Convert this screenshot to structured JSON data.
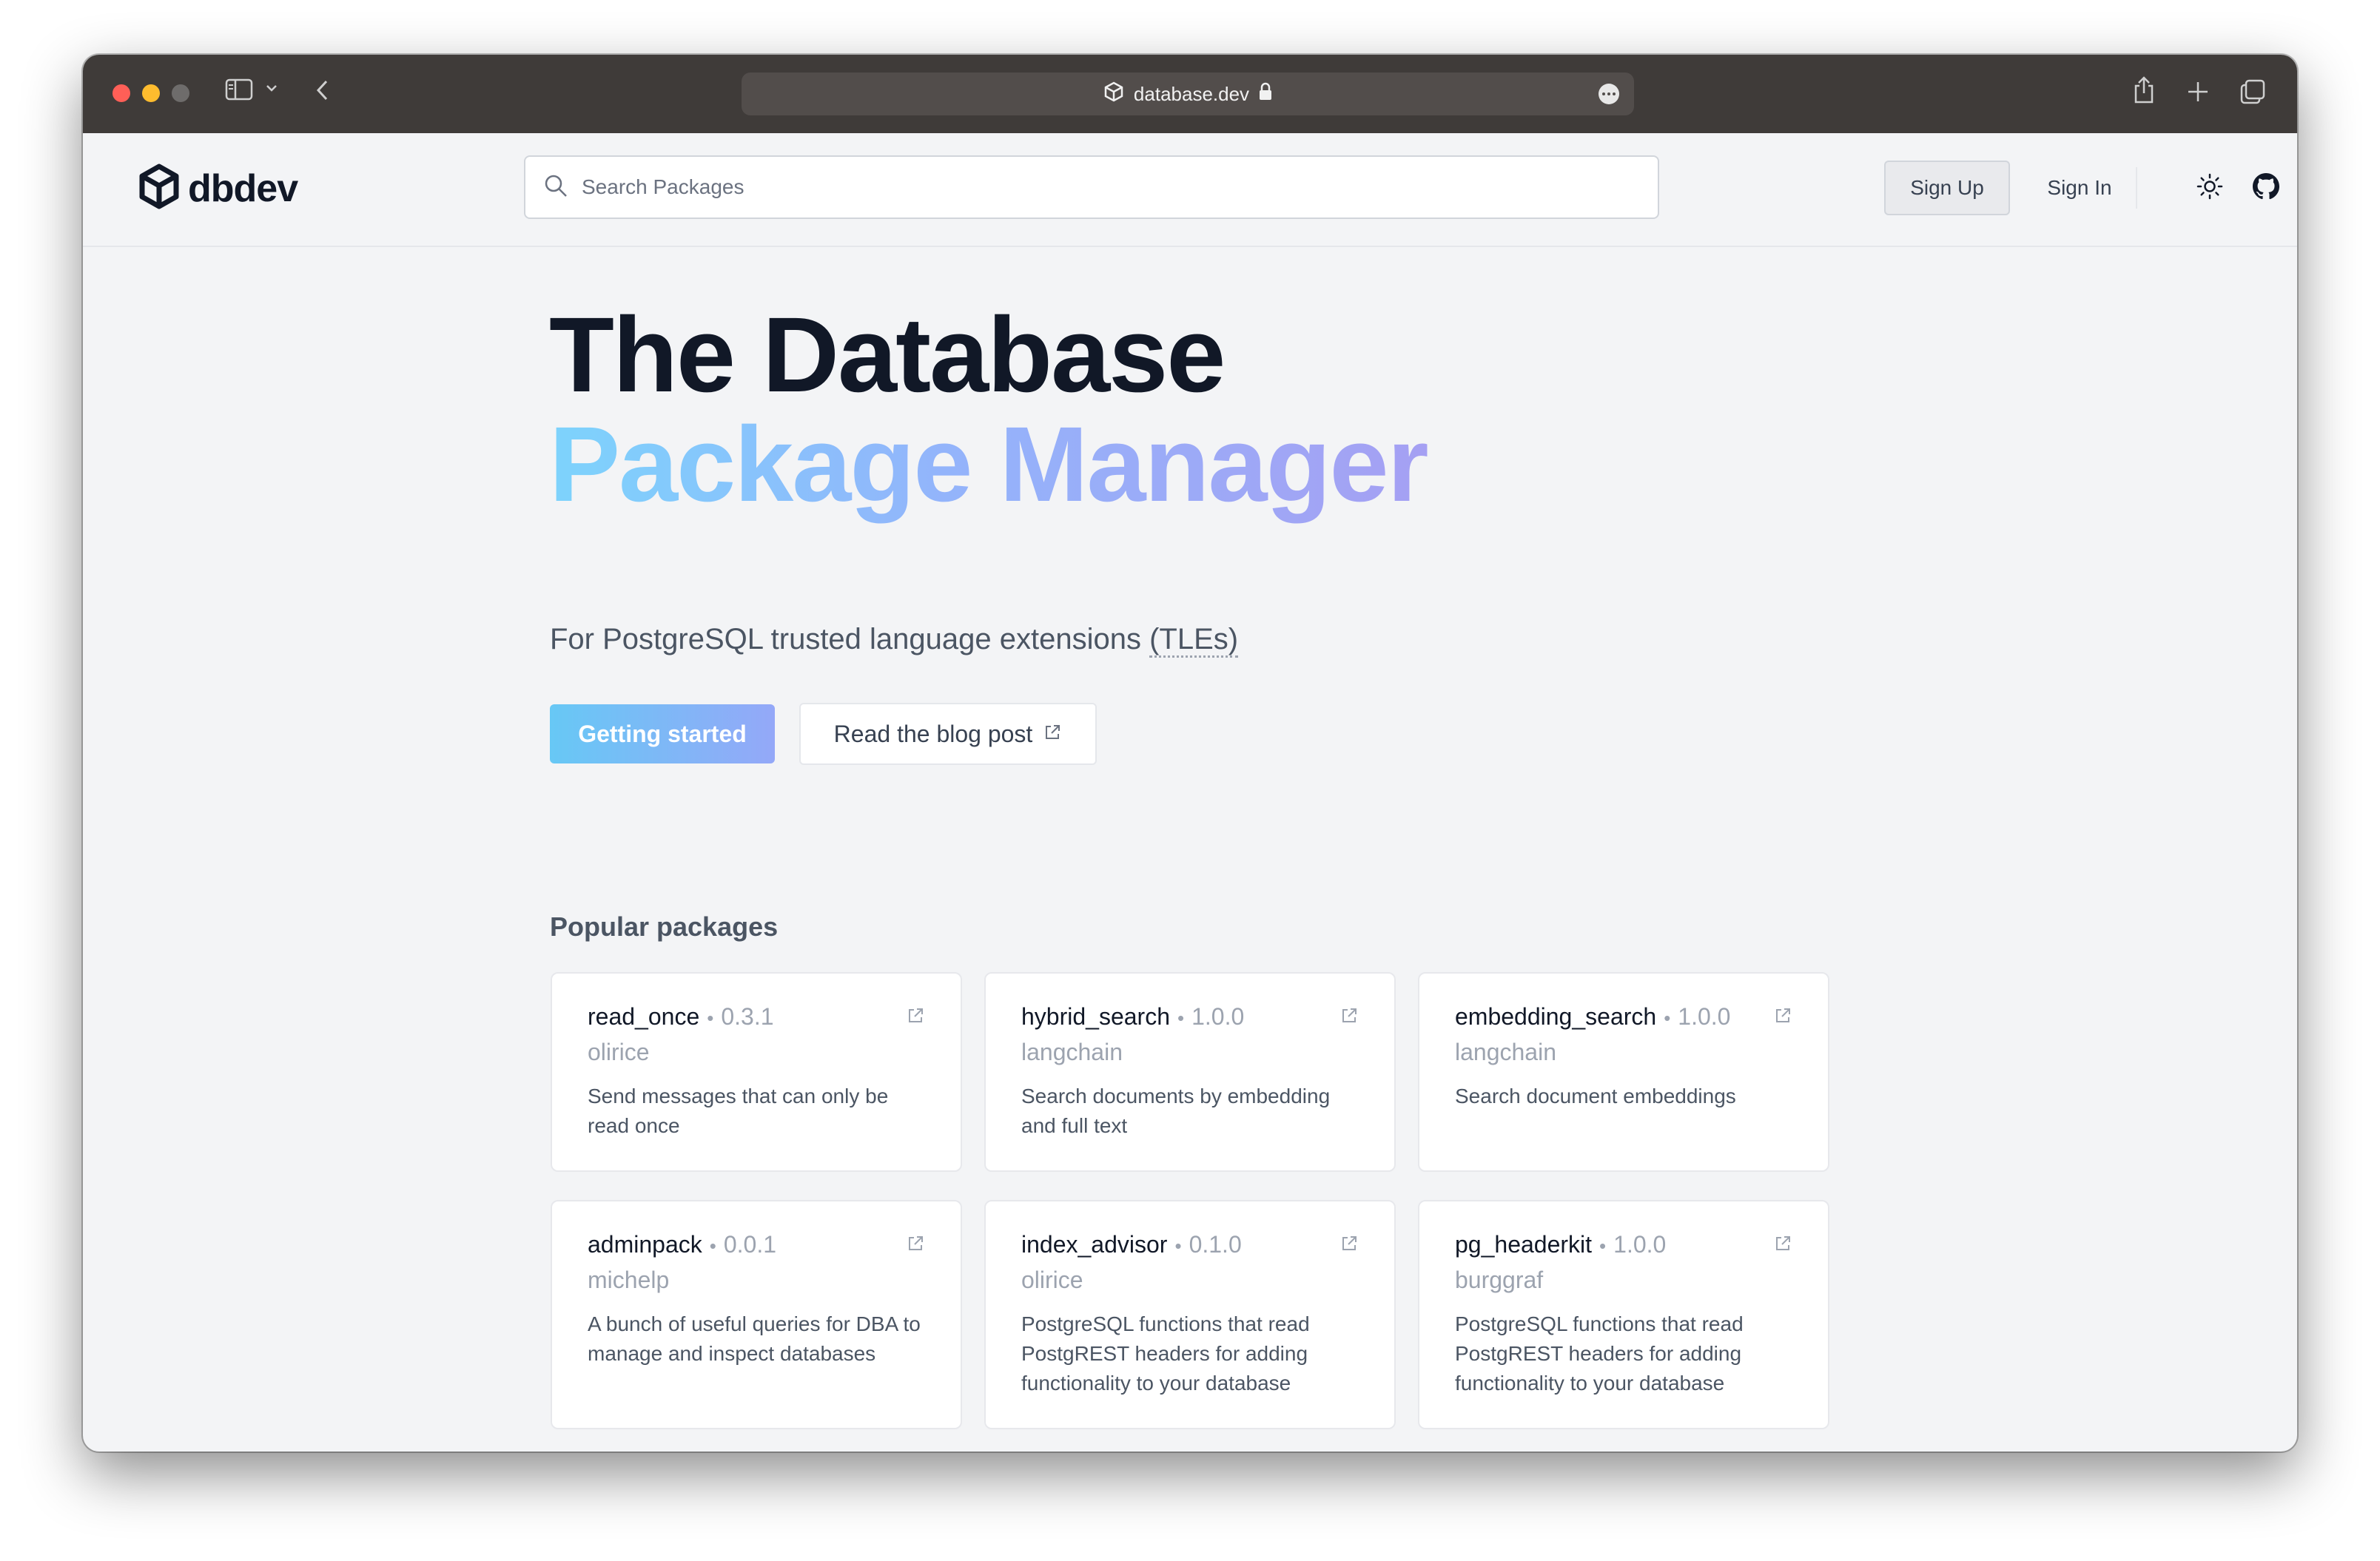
{
  "browser": {
    "url": "database.dev"
  },
  "header": {
    "logo_text": "dbdev",
    "search_placeholder": "Search Packages",
    "signup_label": "Sign Up",
    "signin_label": "Sign In"
  },
  "hero": {
    "title_line1": "The Database",
    "title_line2": "Package Manager",
    "subtitle_prefix": "For PostgreSQL trusted language extensions ",
    "subtitle_tle": "(TLEs)",
    "primary_button": "Getting started",
    "secondary_button": "Read the blog post"
  },
  "popular": {
    "title": "Popular packages",
    "packages": [
      {
        "name": "read_once",
        "version": "0.3.1",
        "author": "olirice",
        "description": "Send messages that can only be read once"
      },
      {
        "name": "hybrid_search",
        "version": "1.0.0",
        "author": "langchain",
        "description": "Search documents by embedding and full text"
      },
      {
        "name": "embedding_search",
        "version": "1.0.0",
        "author": "langchain",
        "description": "Search document embeddings"
      },
      {
        "name": "adminpack",
        "version": "0.0.1",
        "author": "michelp",
        "description": "A bunch of useful queries for DBA to manage and inspect databases"
      },
      {
        "name": "index_advisor",
        "version": "0.1.0",
        "author": "olirice",
        "description": "PostgreSQL functions that read PostgREST headers for adding functionality to your database"
      },
      {
        "name": "pg_headerkit",
        "version": "1.0.0",
        "author": "burggraf",
        "description": "PostgreSQL functions that read PostgREST headers for adding functionality to your database"
      }
    ]
  },
  "colors": {
    "chrome_bg": "#3f3b39",
    "page_bg": "#f3f4f6",
    "accent_gradient_start": "#67c8f5",
    "accent_gradient_end": "#a5a0f3"
  },
  "icons": {
    "logo": "hexagon-cube-icon",
    "search": "search-icon",
    "theme": "sun-icon",
    "github": "github-icon",
    "external": "external-link-icon"
  }
}
